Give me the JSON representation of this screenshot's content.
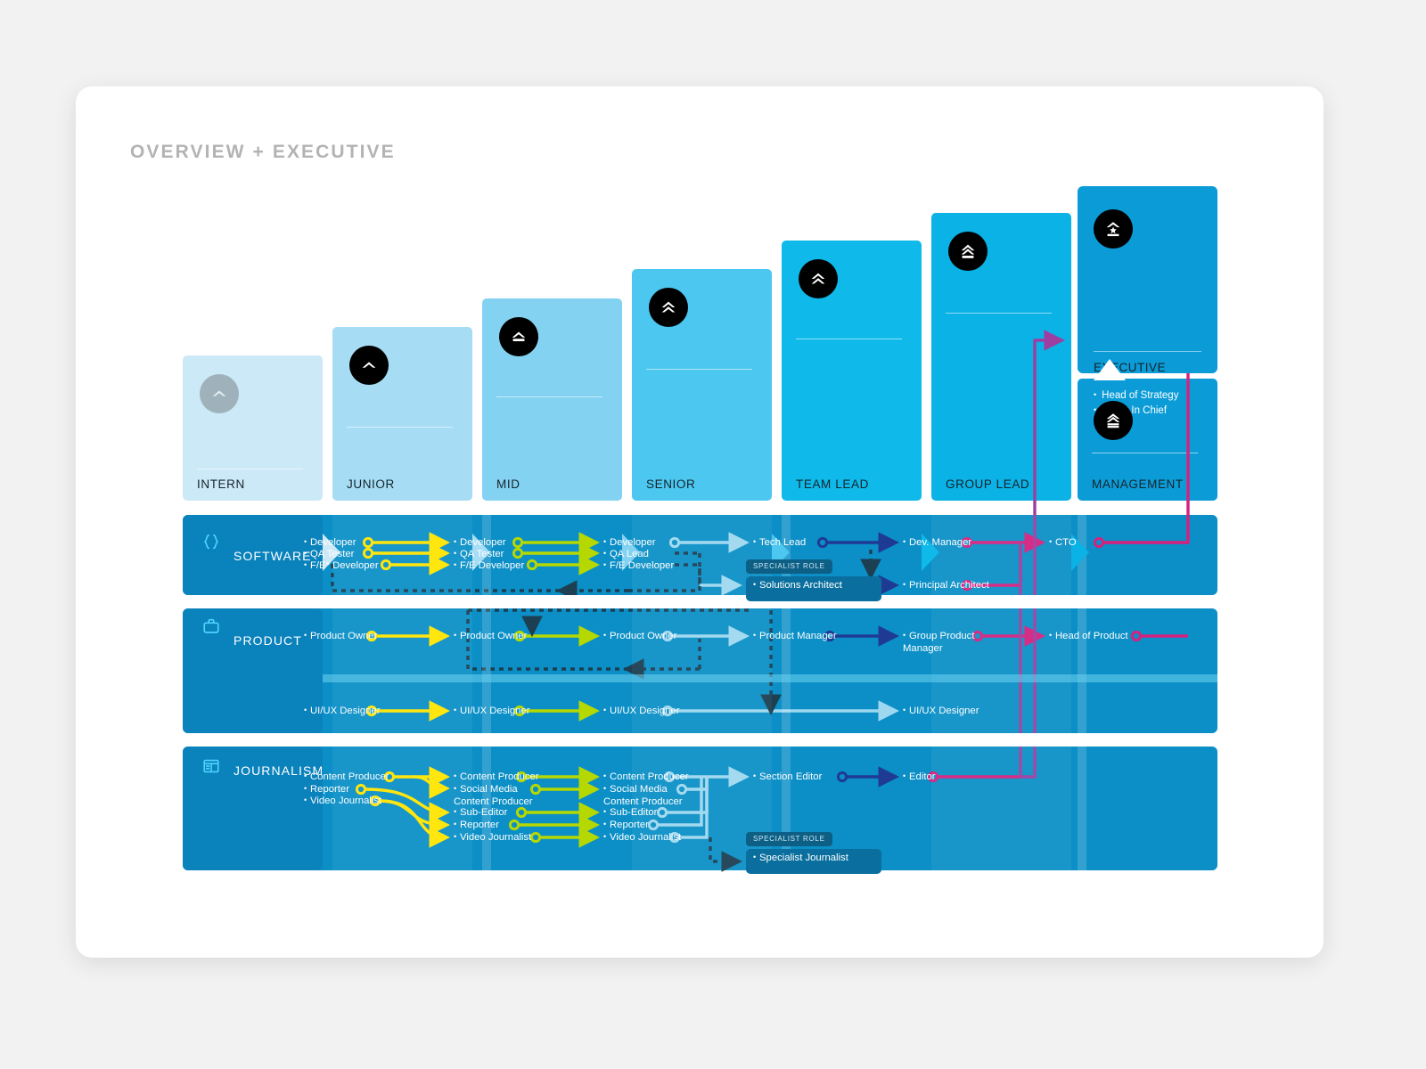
{
  "header": {
    "title": "OVERVIEW + EXECUTIVE"
  },
  "colors": {
    "intern": "#cce9f7",
    "junior": "#a6ddf5",
    "mid": "#84d2f2",
    "senior": "#4cc7f0",
    "team_lead": "#0fb9ea",
    "group_lead": "#0bb2e6",
    "management": "#0b9cd8",
    "band_software": "#0b8fc6",
    "band_product": "#0b8fc6",
    "band_journalism": "#0b8fc6",
    "row_label_bg": "#0a82bc",
    "arrow_coral": "#f4796b",
    "arrow_yellow": "#ffe500",
    "arrow_lime": "#b5d800",
    "arrow_lightblue": "#9ed8f0",
    "arrow_navy": "#1f3a93",
    "arrow_magenta": "#d6217f",
    "arrow_purple": "#9c3fa0",
    "dashed": "#1c3f52"
  },
  "levels": [
    {
      "id": "intern",
      "label": "INTERN",
      "rank_icon": "rank-chevron-1-muted-icon"
    },
    {
      "id": "junior",
      "label": "JUNIOR",
      "rank_icon": "rank-chevron-1-icon"
    },
    {
      "id": "mid",
      "label": "MID",
      "rank_icon": "rank-chevron-1-bar-icon"
    },
    {
      "id": "senior",
      "label": "SENIOR",
      "rank_icon": "rank-chevron-2-icon"
    },
    {
      "id": "team_lead",
      "label": "TEAM LEAD",
      "rank_icon": "rank-chevron-2-icon"
    },
    {
      "id": "group_lead",
      "label": "GROUP LEAD",
      "rank_icon": "rank-chevron-2-bar-icon"
    },
    {
      "id": "management",
      "label": "MANAGEMENT",
      "rank_icon": "rank-chevron-3-bar-icon"
    }
  ],
  "executive": {
    "label": "EXECUTIVE",
    "rank_icon": "rank-chevron-star-icon",
    "roles": [
      "Head of Strategy",
      "Editor In Chief"
    ]
  },
  "specialist_badge_label": "SPECIALIST ROLE",
  "tracks": [
    {
      "id": "software",
      "label": "SOFTWARE",
      "icon": "braces-icon",
      "columns": {
        "junior": [
          "Developer",
          "QA Tester",
          "F/E* Developer"
        ],
        "mid": [
          "Developer",
          "QA Tester",
          "F/E Developer"
        ],
        "senior": [
          "Developer",
          "QA Lead",
          "F/E Developer"
        ],
        "team_lead": [
          "Tech Lead"
        ],
        "group_lead": [
          "Dev. Manager"
        ],
        "management": [
          "CTO"
        ]
      },
      "specialist": {
        "team_lead": "Solutions Architect",
        "group_lead": "Principal Architect"
      }
    },
    {
      "id": "product",
      "label": "PRODUCT",
      "icon": "briefcase-icon",
      "columns": {
        "junior": [
          "Product Owner"
        ],
        "mid": [
          "Product Owner"
        ],
        "senior": [
          "Product Owner"
        ],
        "team_lead": [
          "Product Manager"
        ],
        "group_lead": [
          "Group Product Manager"
        ],
        "management": [
          "Head of Product"
        ]
      },
      "design": {
        "junior": "UI/UX Designer",
        "mid": "UI/UX Designer",
        "senior": "UI/UX Designer",
        "group_lead": "UI/UX Designer"
      }
    },
    {
      "id": "journalism",
      "label": "JOURNALISM",
      "icon": "newspaper-icon",
      "columns": {
        "junior": [
          "Content Producer",
          "Reporter",
          "Video Journalist"
        ],
        "mid": [
          "Content Producer",
          "Social Media Content Producer",
          "Sub-Editor",
          "Reporter",
          "Video Journalist"
        ],
        "senior": [
          "Content Producer",
          "Social Media Content Producer",
          "Sub-Editor",
          "Reporter",
          "Video Journalist"
        ],
        "team_lead": [
          "Section Editor"
        ],
        "group_lead": [
          "Editor"
        ],
        "management": []
      },
      "specialist": {
        "team_lead": "Specialist Journalist"
      }
    }
  ]
}
